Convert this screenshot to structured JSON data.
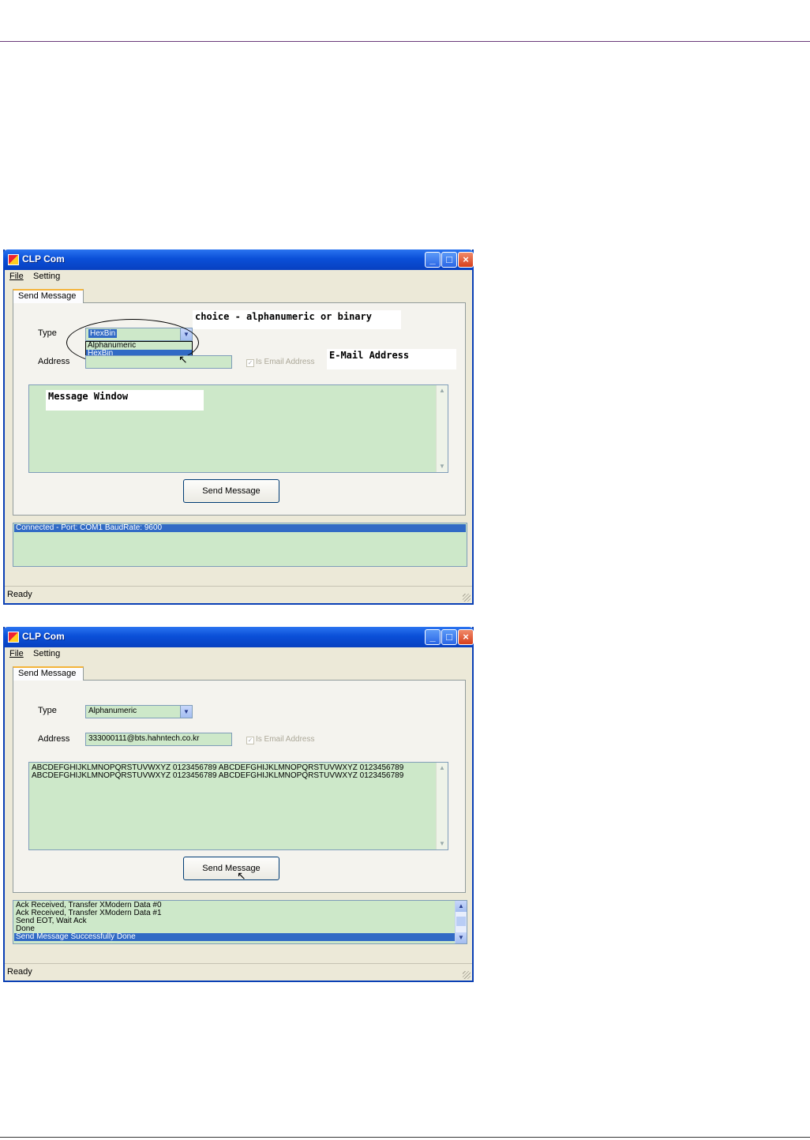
{
  "window_top": {
    "title": "CLP Com",
    "menu": {
      "file": "File",
      "setting": "Setting"
    },
    "tab": "Send Message",
    "type_label": "Type",
    "type_selected": "HexBin",
    "dropdown_options": [
      "Alphanumeric",
      "HexBin"
    ],
    "address_label": "Address",
    "address_value": "",
    "email_checkbox_label": "Is Email Address",
    "message_text": "",
    "send_button": "Send Message",
    "log_lines": [
      "Connected - Port: COM1 BaudRate: 9600"
    ],
    "status": "Ready",
    "annotations": {
      "choice": "choice - alphanumeric or binary",
      "email": "E-Mail Address",
      "message": "Message Window"
    }
  },
  "window_bottom": {
    "title": "CLP Com",
    "menu": {
      "file": "File",
      "setting": "Setting"
    },
    "tab": "Send Message",
    "type_label": "Type",
    "type_selected": "Alphanumeric",
    "address_label": "Address",
    "address_value": "333000111@bts.hahntech.co.kr",
    "email_checkbox_label": "Is Email Address",
    "message_lines": [
      "ABCDEFGHIJKLMNOPQRSTUVWXYZ 0123456789 ABCDEFGHIJKLMNOPQRSTUVWXYZ 0123456789",
      "ABCDEFGHIJKLMNOPQRSTUVWXYZ 0123456789 ABCDEFGHIJKLMNOPQRSTUVWXYZ 0123456789"
    ],
    "send_button": "Send Message",
    "log_lines": [
      "Ack Received, Transfer XModern Data #0",
      "Ack Received, Transfer XModern Data #1",
      "Send EOT, Wait Ack",
      "Done",
      "Send Message Successfully Done"
    ],
    "status": "Ready"
  },
  "colors": {
    "titlebar": "#0a4fd8",
    "field_bg": "#cde8c9",
    "selection": "#316ac5",
    "window_bg": "#ece9d8"
  },
  "icons": {
    "minimize": "minimize-icon",
    "maximize": "maximize-icon",
    "close": "close-icon"
  }
}
